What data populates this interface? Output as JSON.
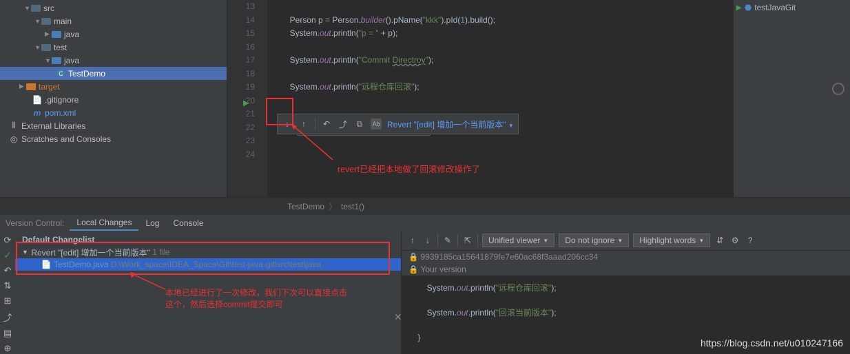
{
  "sidebar": {
    "items": [
      {
        "label": "src",
        "indent": 35
      },
      {
        "label": "main",
        "indent": 50,
        "arrow": "▼"
      },
      {
        "label": "java",
        "indent": 65,
        "arrow": "▶",
        "folderClass": "blue"
      },
      {
        "label": "test",
        "indent": 50,
        "arrow": "▼"
      },
      {
        "label": "java",
        "indent": 65,
        "arrow": "▼",
        "folderClass": "blue"
      },
      {
        "label": "TestDemo",
        "indent": 80,
        "selected": true,
        "fileIcon": "C"
      },
      {
        "label": "target",
        "indent": 35,
        "arrow": "▶",
        "folderClass": "orange"
      },
      {
        "label": ".gitignore",
        "indent": 47,
        "fileIcon": "txt"
      },
      {
        "label": "pom.xml",
        "indent": 47,
        "fileIcon": "m",
        "blue": true
      }
    ],
    "libs": "External Libraries",
    "scratches": "Scratches and Consoles"
  },
  "editor": {
    "lines": [
      "13",
      "14",
      "15",
      "16",
      "17",
      "18",
      "19",
      "20",
      "21",
      "22",
      "23",
      "24"
    ],
    "code14a": "Person p = Person.",
    "code14b": "builder",
    "code14c": "().pName(",
    "code14d": "\"kkk\"",
    "code14e": ").pId(",
    "code14f": "1",
    "code14g": ").build();",
    "code15a": "System.",
    "code15b": "out",
    "code15c": ".println(",
    "code15d": "\"p = \"",
    "code15e": " + p);",
    "code17a": "System.",
    "code17b": "out",
    "code17c": ".println(",
    "code17d": "\"Commit ",
    "code17e": "Directroy",
    "code17f": "\"",
    "code17g": ");",
    "code19a": "System.",
    "code19b": "out",
    "code19c": ".println(",
    "code19d": "\"远程仓库回滚\"",
    "code19e": ");",
    "code22a": "System.out.println(",
    "code22d": "\"回滚当前版本"
  },
  "toolbar": {
    "revert_label": "Revert \"[edit] 增加一个当前版本\""
  },
  "annotation1": "revert已经把本地做了回滚修改操作了",
  "breadcrumb": {
    "a": "TestDemo",
    "b": "test1()"
  },
  "rightPanel": {
    "item": "testJavaGit"
  },
  "vc": {
    "title": "Version Control:",
    "tabs": [
      "Local Changes",
      "Log",
      "Console"
    ],
    "default_cl": "Default Changelist",
    "revert_cl": "Revert \"[edit] 增加一个当前版本\"",
    "revert_count": "1 file",
    "file": "TestDemo.java",
    "file_path": "D:\\Work_space\\IDEA_Space\\Git\\test-java-git\\src\\test\\java"
  },
  "annotation2a": "本地已经进行了一次修改，我们下次可以直接点击",
  "annotation2b": "这个，然后选择commit提交即可",
  "diff": {
    "viewer": "Unified viewer",
    "ignore": "Do not ignore",
    "highlight": "Highlight words",
    "hash": "9939185ca15641879fe7e60ac68f3aaad206cc34",
    "your": "Your version",
    "l1a": "System.",
    "l1b": "out",
    "l1c": ".println(",
    "l1d": "\"远程仓库回滚\"",
    "l1e": ");",
    "l2a": "System.",
    "l2b": "out",
    "l2c": ".println(",
    "l2d": "\"回滚当前版本\"",
    "l2e": ");",
    "brace": "}"
  },
  "watermark": "https://blog.csdn.net/u010247166"
}
